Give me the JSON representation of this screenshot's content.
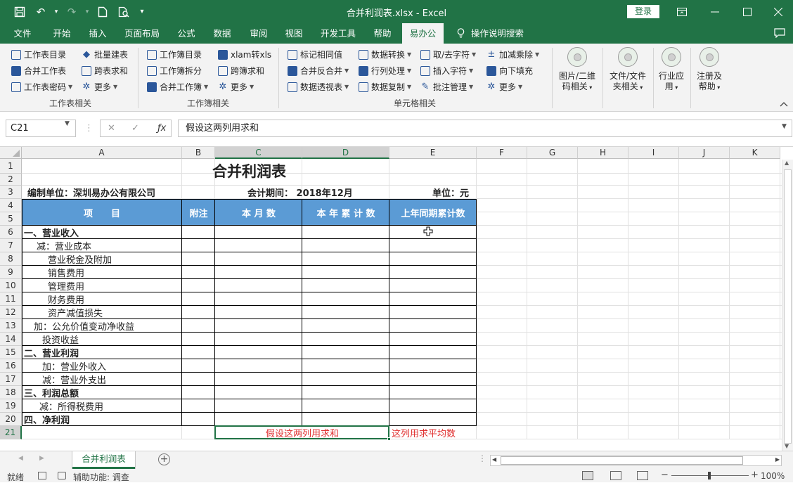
{
  "app": {
    "window_title": "合并利润表.xlsx  -  Excel",
    "sign_in": "登录"
  },
  "tabs": [
    "文件",
    "开始",
    "插入",
    "页面布局",
    "公式",
    "数据",
    "审阅",
    "视图",
    "开发工具",
    "帮助",
    "易办公"
  ],
  "tell_me": "操作说明搜索",
  "ribbon": {
    "group1": {
      "label": "工作表相关",
      "items": [
        "工作表目录",
        "批量建表",
        "合并工作表",
        "跨表求和",
        "工作表密码",
        "更多"
      ]
    },
    "group2": {
      "label": "工作簿相关",
      "items": [
        "工作簿目录",
        "xlam转xls",
        "工作簿拆分",
        "跨簿求和",
        "合并工作簿",
        "更多"
      ]
    },
    "group3": {
      "label": "单元格相关",
      "items": [
        "标记相同值",
        "数据转换",
        "取/去字符",
        "加减乘除",
        "合并反合并",
        "行列处理",
        "插入字符",
        "向下填充",
        "数据透视表",
        "数据复制",
        "批注管理",
        "更多"
      ]
    },
    "big": [
      {
        "line1": "图片/二维",
        "line2": "码相关"
      },
      {
        "line1": "文件/文件",
        "line2": "夹相关"
      },
      {
        "line1": "行业应",
        "line2": "用"
      },
      {
        "line1": "注册及",
        "line2": "帮助"
      }
    ]
  },
  "formula_bar": {
    "name_box": "C21",
    "content": "假设这两列用求和"
  },
  "columns": [
    "A",
    "B",
    "C",
    "D",
    "E",
    "F",
    "G",
    "H",
    "I",
    "J",
    "K"
  ],
  "rows": [
    "1",
    "2",
    "3",
    "4",
    "5",
    "6",
    "7",
    "8",
    "9",
    "10",
    "11",
    "12",
    "13",
    "14",
    "15",
    "16",
    "17",
    "18",
    "19",
    "20",
    "21"
  ],
  "sheet": {
    "title": "合并利润表",
    "company": "编制单位：深圳易办公有限公司",
    "period": "会计期间：  2018年12月",
    "unit": "单位：元",
    "headers": [
      "项　　目",
      "附注",
      "本 月 数",
      "本 年 累 计 数",
      "上年同期累计数"
    ],
    "items": [
      {
        "text": "一、营业收入",
        "bold": true,
        "indent": 0
      },
      {
        "text": "减：营业成本",
        "bold": false,
        "indent": 18
      },
      {
        "text": "营业税金及附加",
        "bold": false,
        "indent": 34
      },
      {
        "text": "销售费用",
        "bold": false,
        "indent": 34
      },
      {
        "text": "管理费用",
        "bold": false,
        "indent": 34
      },
      {
        "text": "财务费用",
        "bold": false,
        "indent": 34
      },
      {
        "text": "资产减值损失",
        "bold": false,
        "indent": 34
      },
      {
        "text": "加：公允价值变动净收益",
        "bold": false,
        "indent": 14
      },
      {
        "text": "投资收益",
        "bold": false,
        "indent": 26
      },
      {
        "text": "二、营业利润",
        "bold": true,
        "indent": 0
      },
      {
        "text": "加：营业外收入",
        "bold": false,
        "indent": 26
      },
      {
        "text": "减：营业外支出",
        "bold": false,
        "indent": 26
      },
      {
        "text": "三、利润总额",
        "bold": true,
        "indent": 0
      },
      {
        "text": "减：所得税费用",
        "bold": false,
        "indent": 22
      },
      {
        "text": "四、净利润",
        "bold": true,
        "indent": 0
      }
    ],
    "note_cd": "假设这两列用求和",
    "note_e": "这列用求平均数",
    "note_color": "#e03030"
  },
  "sheet_tab": "合并利润表",
  "status": {
    "ready": "就绪",
    "accessibility": "辅助功能: 调查",
    "zoom": "100%"
  },
  "colors": {
    "accent": "#217346",
    "header_fill": "#5b9bd5"
  }
}
